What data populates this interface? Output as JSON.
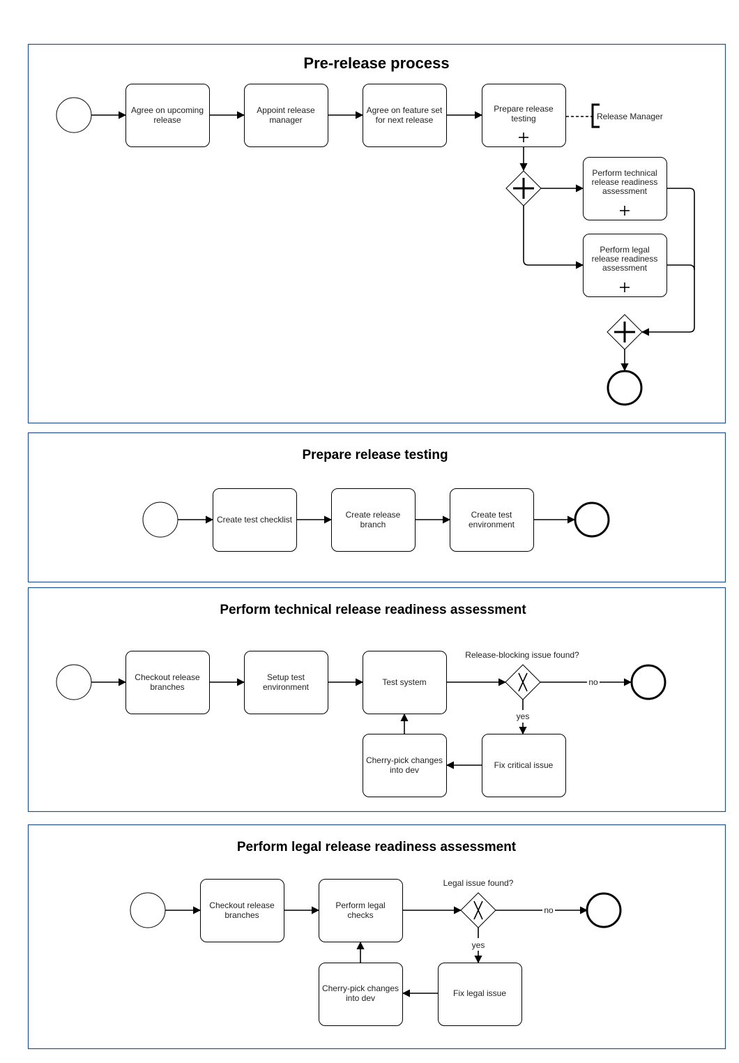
{
  "diagram": {
    "colors": {
      "frame_border": "#23508a",
      "stroke": "#000000",
      "text": "#222222"
    },
    "panels": [
      {
        "id": "pre-release",
        "title": "Pre-release process",
        "tasks": [
          {
            "id": "agree-upcoming",
            "lines": [
              "Agree on upcoming",
              "release"
            ]
          },
          {
            "id": "appoint-manager",
            "lines": [
              "Appoint release",
              "manager"
            ]
          },
          {
            "id": "agree-feature-set",
            "lines": [
              "Agree on feature set",
              "for next release"
            ]
          },
          {
            "id": "prepare-testing",
            "lines": [
              "Prepare release",
              "testing"
            ],
            "subprocess": true
          },
          {
            "id": "technical-assessment",
            "lines": [
              "Perform technical",
              "release readiness",
              "assessment"
            ],
            "subprocess": true
          },
          {
            "id": "legal-assessment",
            "lines": [
              "Perform legal",
              "release readiness",
              "assessment"
            ],
            "subprocess": true
          }
        ],
        "annotation": "Release Manager",
        "gateways": [
          "parallel-split",
          "parallel-join"
        ]
      },
      {
        "id": "prepare-testing",
        "title": "Prepare release testing",
        "tasks": [
          {
            "id": "create-checklist",
            "lines": [
              "Create test checklist"
            ]
          },
          {
            "id": "create-branch",
            "lines": [
              "Create release",
              "branch"
            ]
          },
          {
            "id": "create-env",
            "lines": [
              "Create test",
              "environment"
            ]
          }
        ]
      },
      {
        "id": "technical",
        "title": "Perform technical release readiness assessment",
        "tasks": [
          {
            "id": "checkout",
            "lines": [
              "Checkout release",
              "branches"
            ]
          },
          {
            "id": "setup-env",
            "lines": [
              "Setup test",
              "environment"
            ]
          },
          {
            "id": "test-system",
            "lines": [
              "Test system"
            ]
          },
          {
            "id": "cherry-pick",
            "lines": [
              "Cherry-pick changes",
              "into dev"
            ]
          },
          {
            "id": "fix-critical",
            "lines": [
              "Fix critical issue"
            ]
          }
        ],
        "gateway_question": "Release-blocking issue found?",
        "yes_label": "yes",
        "no_label": "no"
      },
      {
        "id": "legal",
        "title": "Perform legal release readiness assessment",
        "tasks": [
          {
            "id": "checkout",
            "lines": [
              "Checkout release",
              "branches"
            ]
          },
          {
            "id": "legal-checks",
            "lines": [
              "Perform legal",
              "checks"
            ]
          },
          {
            "id": "cherry-pick",
            "lines": [
              "Cherry-pick changes",
              "into dev"
            ]
          },
          {
            "id": "fix-legal",
            "lines": [
              "Fix legal issue"
            ]
          }
        ],
        "gateway_question": "Legal issue found?",
        "yes_label": "yes",
        "no_label": "no"
      }
    ]
  }
}
